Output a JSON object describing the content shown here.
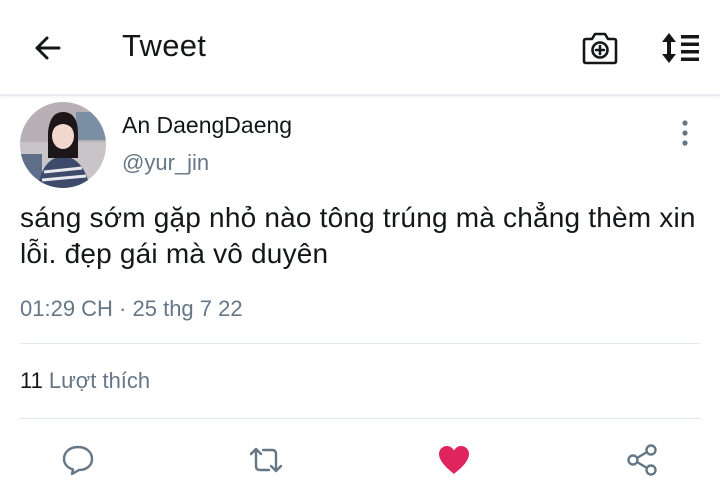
{
  "header": {
    "title": "Tweet",
    "back_icon": "back-arrow-icon",
    "camera_icon": "camera-add-icon",
    "sort_icon": "sort-list-icon"
  },
  "tweet": {
    "author_name": "An DaengDaeng",
    "handle": "@yur_jin",
    "text": "sáng sớm gặp nhỏ nào tông trúng mà chẳng thèm xin lỗi. đẹp gái mà vô duyên",
    "timestamp": "01:29 CH · 25 thg 7 22",
    "likes_count": "11",
    "likes_label": "Lượt thích",
    "liked": true
  },
  "actions": {
    "reply_icon": "reply-icon",
    "retweet_icon": "retweet-icon",
    "like_icon": "heart-icon",
    "share_icon": "share-icon"
  },
  "colors": {
    "text": "#14171a",
    "secondary": "#657786",
    "like": "#e0245e",
    "divider": "#e1e8ed"
  }
}
